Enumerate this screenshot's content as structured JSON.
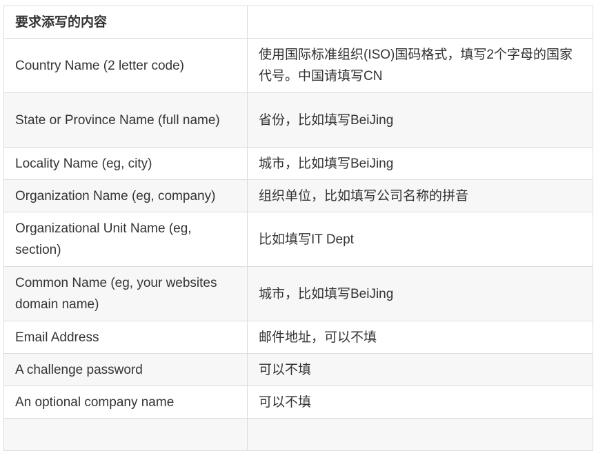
{
  "table": {
    "header": [
      "要求添写的内容",
      ""
    ],
    "rows": [
      [
        "Country Name (2 letter code)",
        "使用国际标准组织(ISO)国码格式，填写2个字母的国家代号。中国请填写CN"
      ],
      [
        "State or Province Name (full name)",
        "省份，比如填写BeiJing"
      ],
      [
        "Locality Name (eg, city)",
        "城市，比如填写BeiJing"
      ],
      [
        "Organization Name (eg, company)",
        "组织单位，比如填写公司名称的拼音"
      ],
      [
        "Organizational Unit Name (eg, section)",
        "比如填写IT Dept"
      ],
      [
        "Common Name (eg, your websites domain name)",
        "城市，比如填写BeiJing"
      ],
      [
        "Email Address",
        "邮件地址，可以不填"
      ],
      [
        "A challenge password",
        "可以不填"
      ],
      [
        "An optional company name",
        "可以不填"
      ],
      [
        "",
        ""
      ]
    ]
  }
}
